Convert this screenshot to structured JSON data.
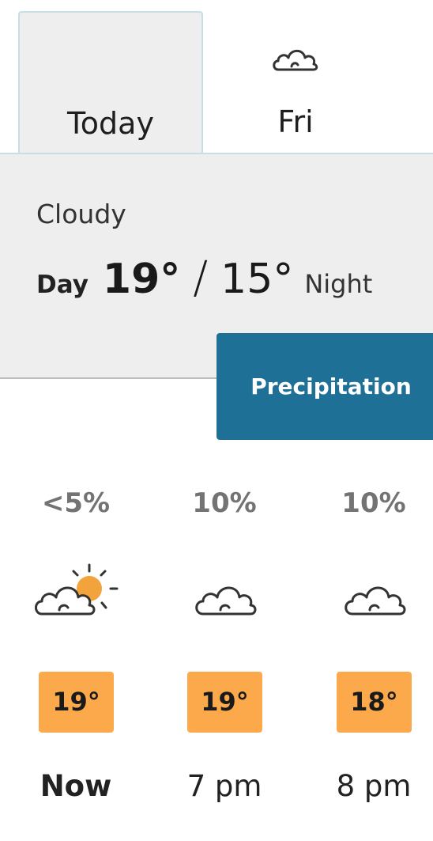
{
  "day_tabs": [
    {
      "label": "Today",
      "selected": true,
      "icon": null
    },
    {
      "label": "Fri",
      "selected": false,
      "icon": "cloud-icon"
    }
  ],
  "summary": {
    "condition": "Cloudy",
    "day_label": "Day",
    "day_temp": "19°",
    "separator": "/",
    "night_temp": "15°",
    "night_label": "Night"
  },
  "precipitation_button": {
    "label": "Precipitation"
  },
  "hourly": [
    {
      "time": "Now",
      "precip": "<5%",
      "icon": "sun-behind-cloud-icon",
      "temp": "19°"
    },
    {
      "time": "7 pm",
      "precip": "10%",
      "icon": "cloud-icon",
      "temp": "19°"
    },
    {
      "time": "8 pm",
      "precip": "10%",
      "icon": "cloud-icon",
      "temp": "18°"
    }
  ],
  "colors": {
    "accent_blue": "#1e7096",
    "temp_badge": "#fca94b",
    "sun": "#f3a33b",
    "panel_bg": "#eeeeee"
  }
}
